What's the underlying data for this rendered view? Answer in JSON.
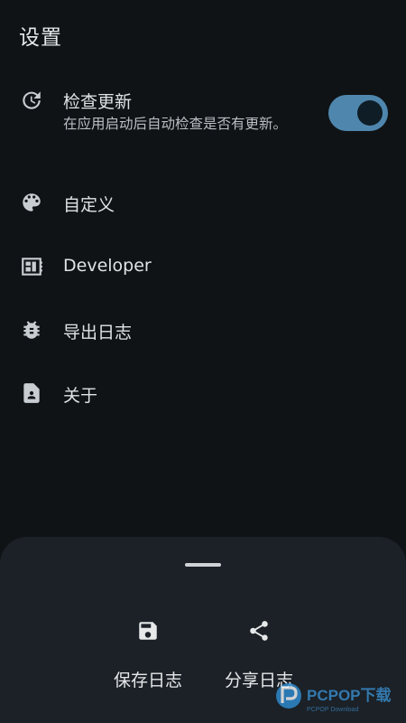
{
  "header": {
    "title": "设置"
  },
  "settings": {
    "items": [
      {
        "label": "检查更新",
        "description": "在应用启动后自动检查是否有更新。",
        "icon": "update-icon",
        "toggle_on": true
      },
      {
        "label": "自定义",
        "icon": "palette-icon"
      },
      {
        "label": "Developer",
        "icon": "developer-board-icon"
      },
      {
        "label": "导出日志",
        "icon": "bug-icon"
      },
      {
        "label": "关于",
        "icon": "contact-page-icon"
      }
    ]
  },
  "bottom_sheet": {
    "actions": [
      {
        "label": "保存日志",
        "icon": "save-icon"
      },
      {
        "label": "分享日志",
        "icon": "share-icon"
      }
    ]
  },
  "watermark": {
    "brand": "PCPOP下载",
    "tagline": "PCPOP Download"
  },
  "colors": {
    "background": "#0f1316",
    "sheet": "#1b2127",
    "accent": "#4f86ad",
    "icon": "#c8cdd1"
  }
}
